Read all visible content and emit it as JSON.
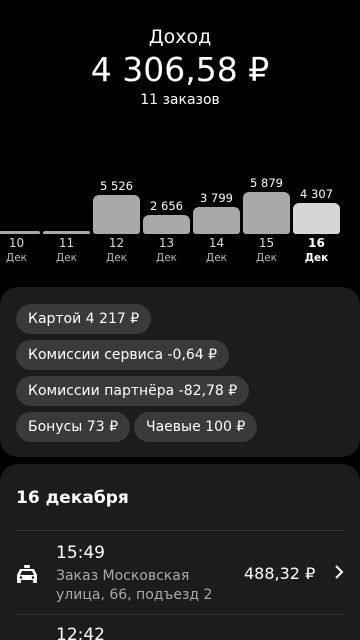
{
  "header": {
    "title": "Доход",
    "amount": "4 306,58 ₽",
    "orders_count": "11 заказов"
  },
  "chart_data": {
    "type": "bar",
    "categories": [
      "10",
      "11",
      "12",
      "13",
      "14",
      "15",
      "16"
    ],
    "month_labels": [
      "Дек",
      "Дек",
      "Дек",
      "Дек",
      "Дек",
      "Дек",
      "Дек"
    ],
    "values": [
      0,
      0,
      5526,
      2656,
      3799,
      5879,
      4307
    ],
    "value_labels": [
      "",
      "",
      "5 526",
      "2 656",
      "3 799",
      "5 879",
      "4 307"
    ],
    "selected_index": 6
  },
  "breakdown": {
    "card": "Картой 4 217 ₽",
    "service_fee": "Комиссии сервиса -0,64 ₽",
    "partner_fee": "Комиссии партнёра -82,78 ₽",
    "bonus": "Бонусы 73 ₽",
    "tips": "Чаевые 100 ₽"
  },
  "orders_list": {
    "date": "16 декабря",
    "items": [
      {
        "time": "15:49",
        "description": "Заказ Московская улица, 66, подъезд 2",
        "amount": "488,32 ₽",
        "icon": "taxi-icon"
      },
      {
        "time": "12:42"
      }
    ]
  }
}
